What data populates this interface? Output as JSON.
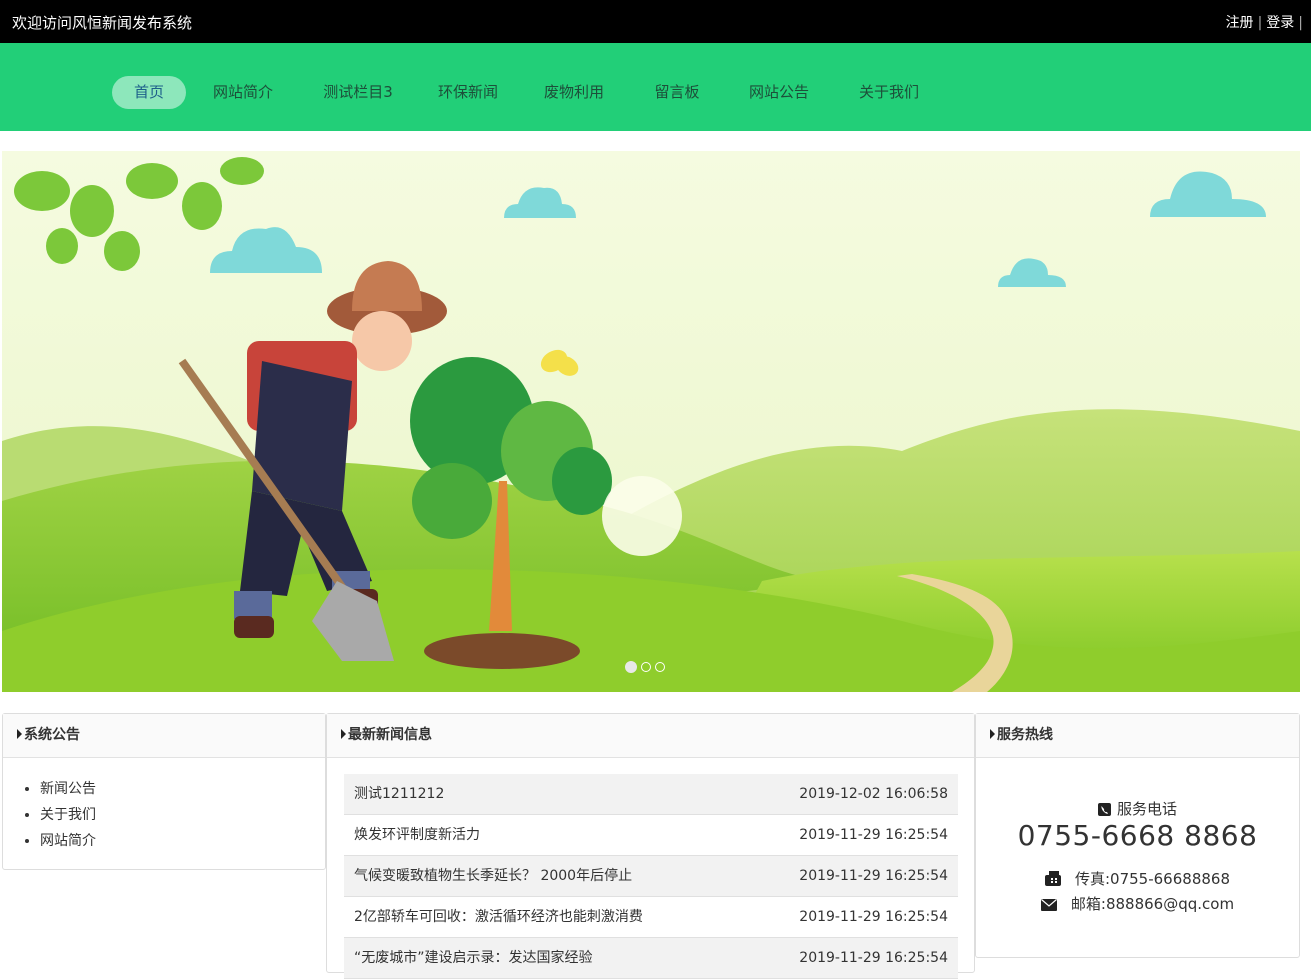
{
  "topbar": {
    "welcome": "欢迎访问风恒新闻发布系统",
    "register": "注册",
    "login": "登录"
  },
  "nav": {
    "items": [
      {
        "label": "首页",
        "active": true
      },
      {
        "label": "网站简介"
      },
      {
        "label": "测试栏目3"
      },
      {
        "label": "环保新闻"
      },
      {
        "label": "废物利用"
      },
      {
        "label": "留言板"
      },
      {
        "label": "网站公告"
      },
      {
        "label": "关于我们"
      }
    ]
  },
  "banner": {
    "slide_count": 3,
    "active_slide": 1
  },
  "notice_panel": {
    "title": "系统公告",
    "items": [
      "新闻公告",
      "关于我们",
      "网站简介"
    ]
  },
  "news_panel": {
    "title": "最新新闻信息",
    "rows": [
      {
        "title": "测试1211212",
        "date": "2019-12-02 16:06:58"
      },
      {
        "title": "焕发环评制度新活力",
        "date": "2019-11-29 16:25:54"
      },
      {
        "title": "气候变暖致植物生长季延长？ 2000年后停止",
        "date": "2019-11-29 16:25:54"
      },
      {
        "title": "2亿部轿车可回收：激活循环经济也能刺激消费",
        "date": "2019-11-29 16:25:54"
      },
      {
        "title": "“无废城市”建设启示录：发达国家经验",
        "date": "2019-11-29 16:25:54"
      }
    ]
  },
  "hotline_panel": {
    "title": "服务热线",
    "phone_label": "服务电话",
    "phone": "0755-6668 8868",
    "fax": "传真:0755-66688868",
    "email": "邮箱:888866@qq.com"
  },
  "colors": {
    "topbar": "#000000",
    "nav": "#22cf78",
    "nav_active": "#8de7bb"
  }
}
